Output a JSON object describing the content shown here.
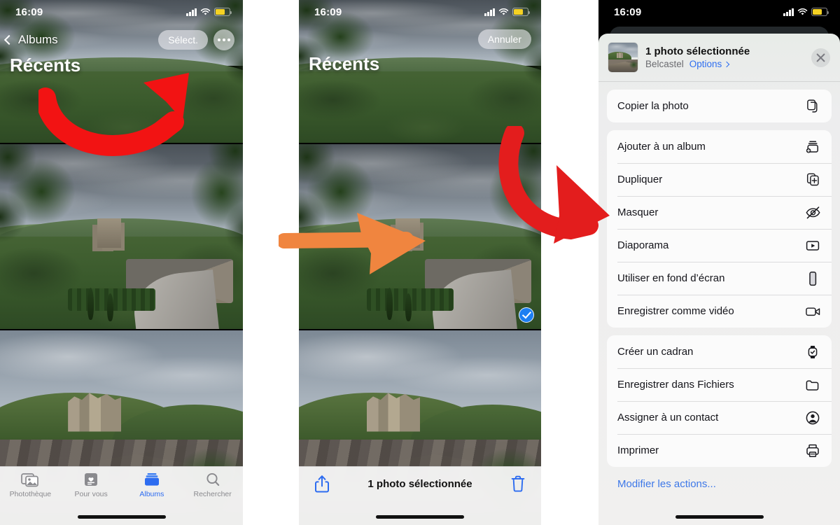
{
  "status_bar": {
    "time": "16:09",
    "cellular": "signal-bars-icon",
    "wifi": "wifi-icon",
    "battery": "battery-low-power-icon"
  },
  "panel1": {
    "back_label": "Albums",
    "select_label": "Sélect.",
    "more_label": "•••",
    "title": "Récents",
    "tabs": [
      {
        "label": "Photothèque",
        "icon": "photos-library-icon",
        "active": false
      },
      {
        "label": "Pour vous",
        "icon": "for-you-icon",
        "active": false
      },
      {
        "label": "Albums",
        "icon": "albums-icon",
        "active": true
      },
      {
        "label": "Rechercher",
        "icon": "search-icon",
        "active": false
      }
    ]
  },
  "panel2": {
    "cancel_label": "Annuler",
    "title": "Récents",
    "share_icon": "share-icon",
    "selection_text": "1 photo sélectionnée",
    "trash_icon": "trash-icon",
    "selected_badge": "checkmark-circle-icon"
  },
  "panel3": {
    "header": {
      "title": "1 photo sélectionnée",
      "subtitle": "Belcastel",
      "options_label": "Options",
      "close_icon": "close-icon",
      "thumbnail": "photo-thumbnail"
    },
    "groups": [
      {
        "items": [
          {
            "label": "Copier la photo",
            "icon": "copy-icon"
          }
        ]
      },
      {
        "items": [
          {
            "label": "Ajouter à un album",
            "icon": "add-to-album-icon"
          },
          {
            "label": "Dupliquer",
            "icon": "duplicate-icon"
          },
          {
            "label": "Masquer",
            "icon": "eye-slash-icon"
          },
          {
            "label": "Diaporama",
            "icon": "slideshow-icon"
          },
          {
            "label": "Utiliser en fond d’écran",
            "icon": "wallpaper-icon"
          },
          {
            "label": "Enregistrer comme vidéo",
            "icon": "video-icon"
          }
        ]
      },
      {
        "items": [
          {
            "label": "Créer un cadran",
            "icon": "watch-face-icon"
          },
          {
            "label": "Enregistrer dans Fichiers",
            "icon": "folder-icon"
          },
          {
            "label": "Assigner à un contact",
            "icon": "contact-icon"
          },
          {
            "label": "Imprimer",
            "icon": "printer-icon"
          }
        ]
      }
    ],
    "edit_actions_label": "Modifier les actions..."
  },
  "annotations": {
    "arrow1": {
      "name": "red-curved-arrow-to-more-button",
      "color": "#F21313"
    },
    "arrow2": {
      "name": "orange-arrow-to-photo",
      "color": "#F0853F"
    },
    "arrow3": {
      "name": "red-curved-arrow-to-share-sheet",
      "color": "#E31D1D"
    }
  },
  "colors": {
    "accent_blue": "#2d6cf0",
    "link_blue": "#3d78e8",
    "selection_blue": "#1c7ff2",
    "battery_yellow": "#f5d223"
  }
}
